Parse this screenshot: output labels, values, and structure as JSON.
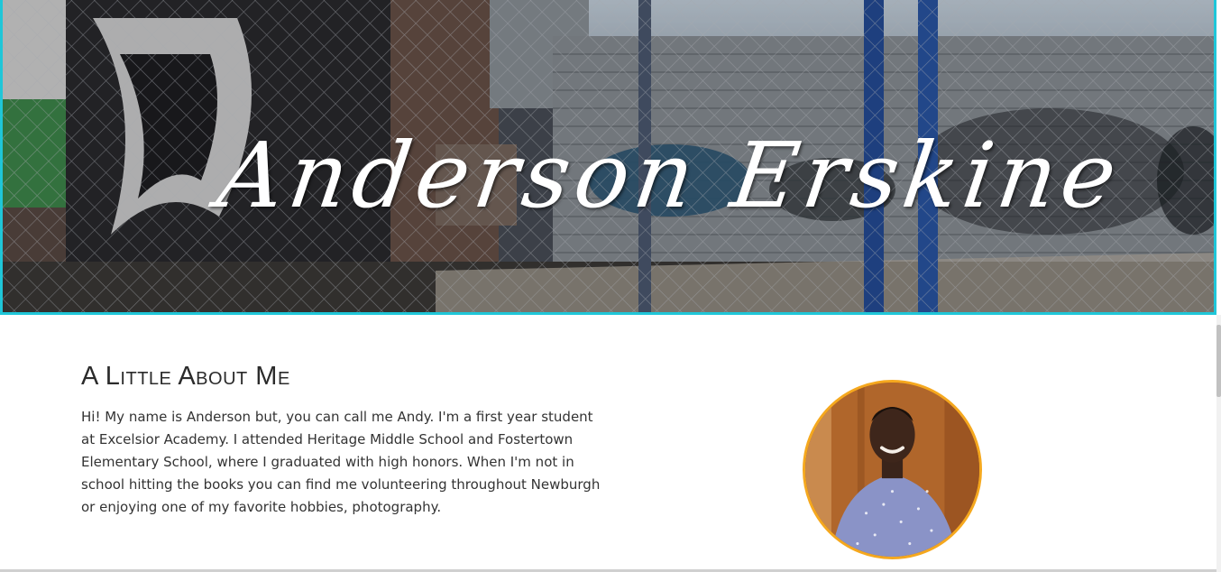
{
  "hero": {
    "title": "Anderson Erskine",
    "background_image": "urban-graffiti-fence-photo",
    "border_color": "#1fc6d8"
  },
  "about": {
    "heading": "A Little About Me",
    "body": "Hi! My name is Anderson but, you can call me Andy. I'm a first year student at Excelsior Academy. I attended Heritage Middle School and Fostertown Elementary School, where I graduated with high honors. When I'm not in school hitting the books you can find me volunteering throughout Newburgh or enjoying one of my favorite hobbies, photography.",
    "avatar_border_color": "#f5a81e"
  }
}
